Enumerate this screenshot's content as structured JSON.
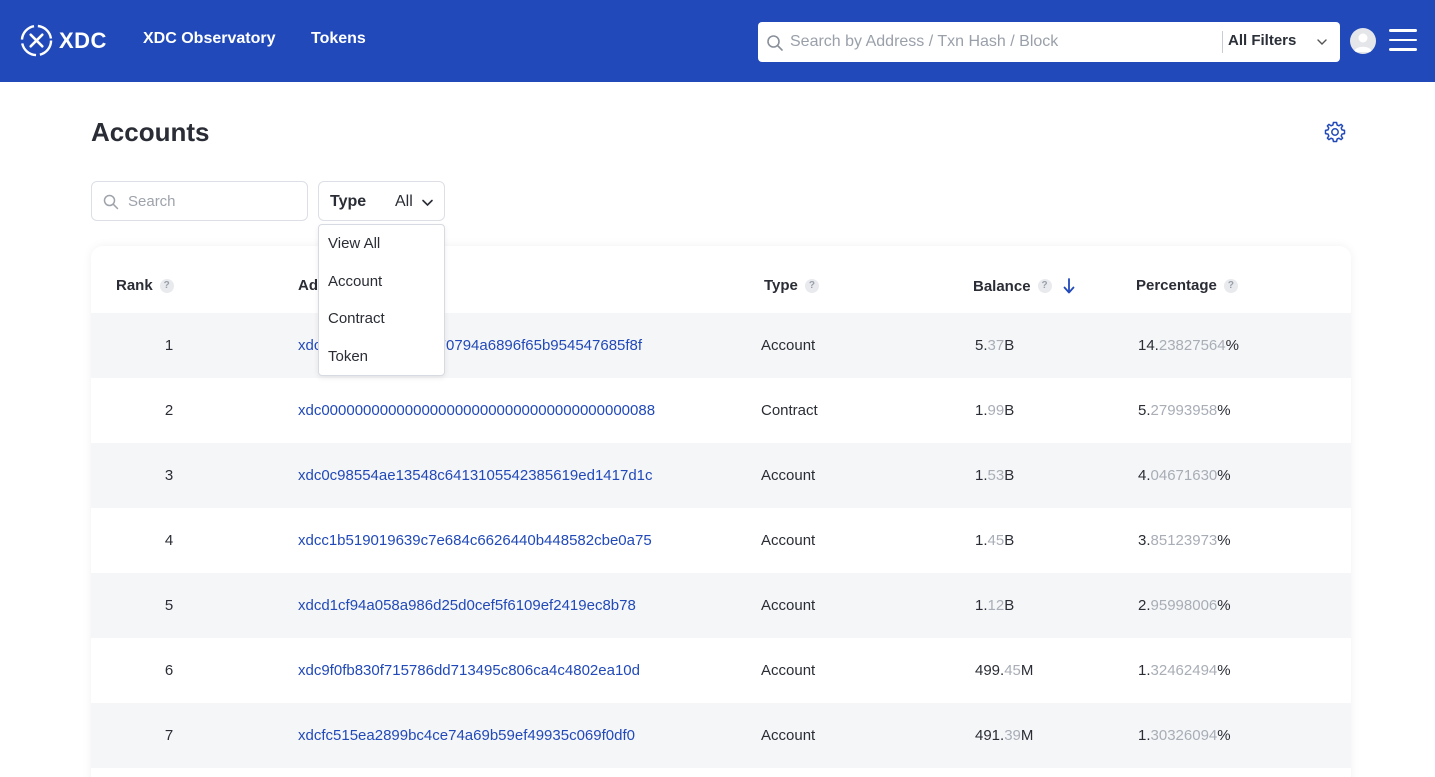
{
  "header": {
    "brand": "XDC",
    "nav": [
      "XDC Observatory",
      "Tokens"
    ],
    "search_placeholder": "Search by Address / Txn Hash / Block",
    "filter_label": "All Filters"
  },
  "page": {
    "title": "Accounts",
    "search_placeholder": "Search",
    "type_filter_label": "Type",
    "type_filter_value": "All",
    "type_options": [
      "View All",
      "Account",
      "Contract",
      "Token"
    ]
  },
  "table": {
    "headers": {
      "rank": "Rank",
      "address": "Address",
      "type": "Type",
      "balance": "Balance",
      "percentage": "Percentage"
    },
    "rows": [
      {
        "rank": "1",
        "address": "xdc",
        "address_tail": "070794a6896f65b954547685f8f",
        "type": "Account",
        "bal_int": "5.",
        "bal_dec": "37",
        "bal_unit": "B",
        "pct_int": "14.",
        "pct_dec": "23827564",
        "pct_unit": "%"
      },
      {
        "rank": "2",
        "address": "xdc0000000000000000000000000000000000000088",
        "address_tail": "",
        "type": "Contract",
        "bal_int": "1.",
        "bal_dec": "99",
        "bal_unit": "B",
        "pct_int": "5.",
        "pct_dec": "27993958",
        "pct_unit": "%"
      },
      {
        "rank": "3",
        "address": "xdc0c98554ae13548c6413105542385619ed1417d1c",
        "address_tail": "",
        "type": "Account",
        "bal_int": "1.",
        "bal_dec": "53",
        "bal_unit": "B",
        "pct_int": "4.",
        "pct_dec": "04671630",
        "pct_unit": "%"
      },
      {
        "rank": "4",
        "address": "xdcc1b519019639c7e684c6626440b448582cbe0a75",
        "address_tail": "",
        "type": "Account",
        "bal_int": "1.",
        "bal_dec": "45",
        "bal_unit": "B",
        "pct_int": "3.",
        "pct_dec": "85123973",
        "pct_unit": "%"
      },
      {
        "rank": "5",
        "address": "xdcd1cf94a058a986d25d0cef5f6109ef2419ec8b78",
        "address_tail": "",
        "type": "Account",
        "bal_int": "1.",
        "bal_dec": "12",
        "bal_unit": "B",
        "pct_int": "2.",
        "pct_dec": "95998006",
        "pct_unit": "%"
      },
      {
        "rank": "6",
        "address": "xdc9f0fb830f715786dd713495c806ca4c4802ea10d",
        "address_tail": "",
        "type": "Account",
        "bal_int": "499.",
        "bal_dec": "45",
        "bal_unit": "M",
        "pct_int": "1.",
        "pct_dec": "32462494",
        "pct_unit": "%"
      },
      {
        "rank": "7",
        "address": "xdcfc515ea2899bc4ce74a69b59ef49935c069f0df0",
        "address_tail": "",
        "type": "Account",
        "bal_int": "491.",
        "bal_dec": "39",
        "bal_unit": "M",
        "pct_int": "1.",
        "pct_dec": "30326094",
        "pct_unit": "%"
      }
    ]
  },
  "colors": {
    "brand_blue": "#2149b9",
    "link_blue": "#2149b9",
    "row_alt": "#f5f6f8"
  }
}
